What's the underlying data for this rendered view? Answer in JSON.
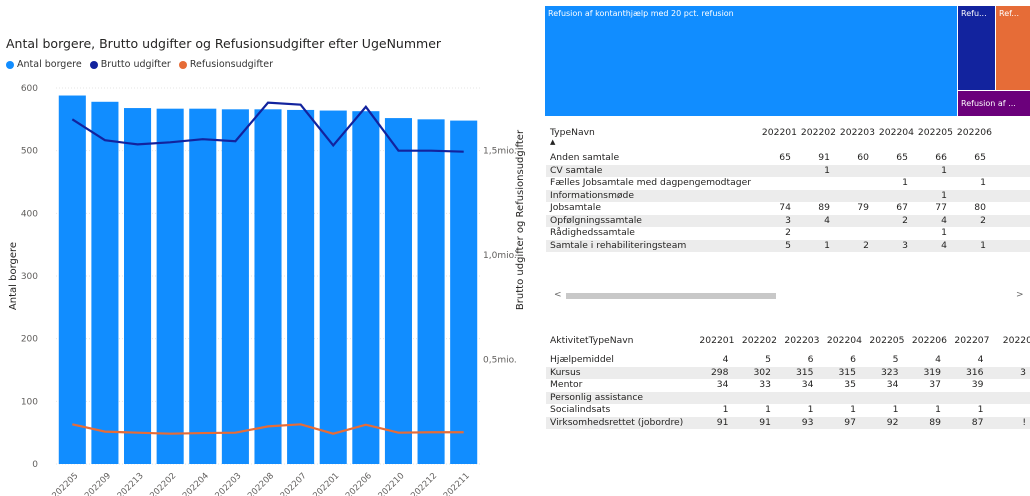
{
  "chart_data": [
    {
      "type": "bar+line",
      "title": "Antal borgere, Brutto udgifter og Refusionsudgifter efter UgeNummer",
      "ylabel": "Antal borgere",
      "y2label": "Brutto udgifter og Refusionsudgifter",
      "ylim": [
        0,
        600
      ],
      "yticks": [
        "0",
        "100",
        "200",
        "300",
        "400",
        "500",
        "600"
      ],
      "y2lim": [
        0,
        1800000
      ],
      "y2ticks": [
        "0,5mio.",
        "1,0mio.",
        "1,5mio."
      ],
      "categories": [
        "202205",
        "202209",
        "202213",
        "202202",
        "202204",
        "202203",
        "202208",
        "202207",
        "202201",
        "202206",
        "202210",
        "202212",
        "202211"
      ],
      "series": [
        {
          "name": "Antal borgere",
          "kind": "bar",
          "color": "#118DFF",
          "values": [
            588,
            578,
            568,
            567,
            567,
            566,
            566,
            565,
            564,
            563,
            552,
            550,
            548
          ]
        },
        {
          "name": "Brutto udgifter",
          "kind": "line",
          "axis": "y2",
          "color": "#12239E",
          "values": [
            1650000,
            1550000,
            1530000,
            1540000,
            1555000,
            1545000,
            1730000,
            1720000,
            1525000,
            1710000,
            1500000,
            1500000,
            1495000
          ]
        },
        {
          "name": "Refusionsudgifter",
          "kind": "line",
          "axis": "y2",
          "color": "#E66C37",
          "values": [
            190000,
            155000,
            150000,
            145000,
            148000,
            150000,
            180000,
            190000,
            145000,
            188000,
            150000,
            152000,
            152000
          ]
        }
      ],
      "grid": true,
      "legend": "top-left"
    }
  ],
  "treemap": [
    {
      "label": "Refusion af kontanthjælp med 20 pct. refusion",
      "color": "#118DFF"
    },
    {
      "label": "Refu...",
      "color": "#12239E"
    },
    {
      "label": "Ref...",
      "color": "#E66C37"
    },
    {
      "label": "Refusion af ...",
      "color": "#6B007B"
    }
  ],
  "matrix1": {
    "header": "TypeNavn",
    "columns": [
      "202201",
      "202202",
      "202203",
      "202204",
      "202205",
      "202206"
    ],
    "rows": [
      {
        "label": "Anden samtale",
        "values": [
          "65",
          "91",
          "60",
          "65",
          "66",
          "65"
        ]
      },
      {
        "label": "CV samtale",
        "values": [
          "",
          "1",
          "",
          "",
          "1",
          ""
        ]
      },
      {
        "label": "Fælles Jobsamtale med dagpengemodtager",
        "values": [
          "",
          "",
          "",
          "1",
          "",
          "1"
        ]
      },
      {
        "label": "Informationsmøde",
        "values": [
          "",
          "",
          "",
          "",
          "1",
          ""
        ]
      },
      {
        "label": "Jobsamtale",
        "values": [
          "74",
          "89",
          "79",
          "67",
          "77",
          "80"
        ]
      },
      {
        "label": "Opfølgningssamtale",
        "values": [
          "3",
          "4",
          "",
          "2",
          "4",
          "2"
        ]
      },
      {
        "label": "Rådighedssamtale",
        "values": [
          "2",
          "",
          "",
          "",
          "1",
          ""
        ]
      },
      {
        "label": "Samtale i rehabiliteringsteam",
        "values": [
          "5",
          "1",
          "2",
          "3",
          "4",
          "1"
        ]
      }
    ]
  },
  "matrix2": {
    "header": "AktivitetTypeNavn",
    "columns": [
      "202201",
      "202202",
      "202203",
      "202204",
      "202205",
      "202206",
      "202207",
      "20220"
    ],
    "rows": [
      {
        "label": "Hjælpemiddel",
        "values": [
          "4",
          "5",
          "6",
          "6",
          "5",
          "4",
          "4",
          ""
        ]
      },
      {
        "label": "Kursus",
        "values": [
          "298",
          "302",
          "315",
          "315",
          "323",
          "319",
          "316",
          "3"
        ]
      },
      {
        "label": "Mentor",
        "values": [
          "34",
          "33",
          "34",
          "35",
          "34",
          "37",
          "39",
          ""
        ]
      },
      {
        "label": "Personlig assistance",
        "values": [
          "",
          "",
          "",
          "",
          "",
          "",
          "",
          ""
        ]
      },
      {
        "label": "Socialindsats",
        "values": [
          "1",
          "1",
          "1",
          "1",
          "1",
          "1",
          "1",
          ""
        ]
      },
      {
        "label": "Virksomhedsrettet (jobordre)",
        "values": [
          "91",
          "91",
          "93",
          "97",
          "92",
          "89",
          "87",
          "!"
        ]
      }
    ]
  },
  "scroll": {
    "left": "<",
    "right": ">"
  }
}
